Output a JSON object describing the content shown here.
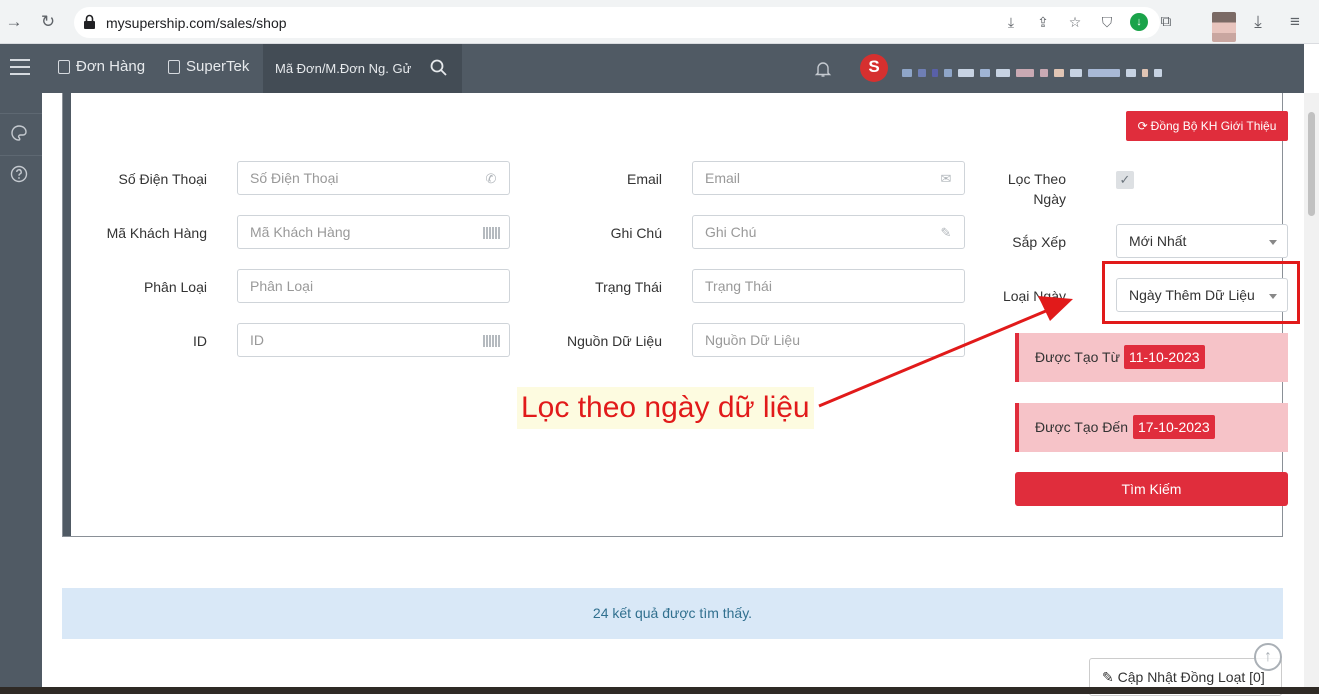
{
  "browser": {
    "url": "mysupership.com/sales/shop"
  },
  "header": {
    "nav": [
      {
        "label": "Đơn Hàng"
      },
      {
        "label": "SuperTek"
      }
    ],
    "search_placeholder": "Mã Đơn/M.Đơn Ng. Gử",
    "brand_letter": "S"
  },
  "filters": {
    "sync_button": "Đồng Bộ KH Giới Thiệu",
    "phone": {
      "label": "Số Điện Thoại",
      "placeholder": "Số Điện Thoại"
    },
    "email": {
      "label": "Email",
      "placeholder": "Email"
    },
    "customer_code": {
      "label": "Mã Khách Hàng",
      "placeholder": "Mã Khách Hàng"
    },
    "note": {
      "label": "Ghi Chú",
      "placeholder": "Ghi Chú"
    },
    "category": {
      "label": "Phân Loại",
      "placeholder": "Phân Loại"
    },
    "status": {
      "label": "Trạng Thái",
      "placeholder": "Trạng Thái"
    },
    "id": {
      "label": "ID",
      "placeholder": "ID"
    },
    "source": {
      "label": "Nguồn Dữ Liệu",
      "placeholder": "Nguồn Dữ Liệu"
    },
    "filter_by_date": {
      "label_line1": "Lọc Theo",
      "label_line2": "Ngày",
      "checked": true
    },
    "sort": {
      "label": "Sắp Xếp",
      "value": "Mới Nhất"
    },
    "date_type": {
      "label": "Loại Ngày",
      "value": "Ngày Thêm Dữ Liệu"
    },
    "created_from": {
      "label": "Được Tạo Từ",
      "value": "11-10-2023"
    },
    "created_to": {
      "label": "Được Tạo Đến",
      "value": "17-10-2023"
    },
    "search_button": "Tìm Kiếm"
  },
  "annotation": {
    "text": "Lọc theo ngày dữ liệu",
    "color": "#e11a1a"
  },
  "results": {
    "summary": "24 kết quả được tìm thấy.",
    "bulk_update_button": "Cập Nhật Đồng Loạt [0]"
  },
  "colors": {
    "accent": "#e02d3c",
    "header_bg": "#505a64",
    "result_bg": "#d9e8f7"
  }
}
